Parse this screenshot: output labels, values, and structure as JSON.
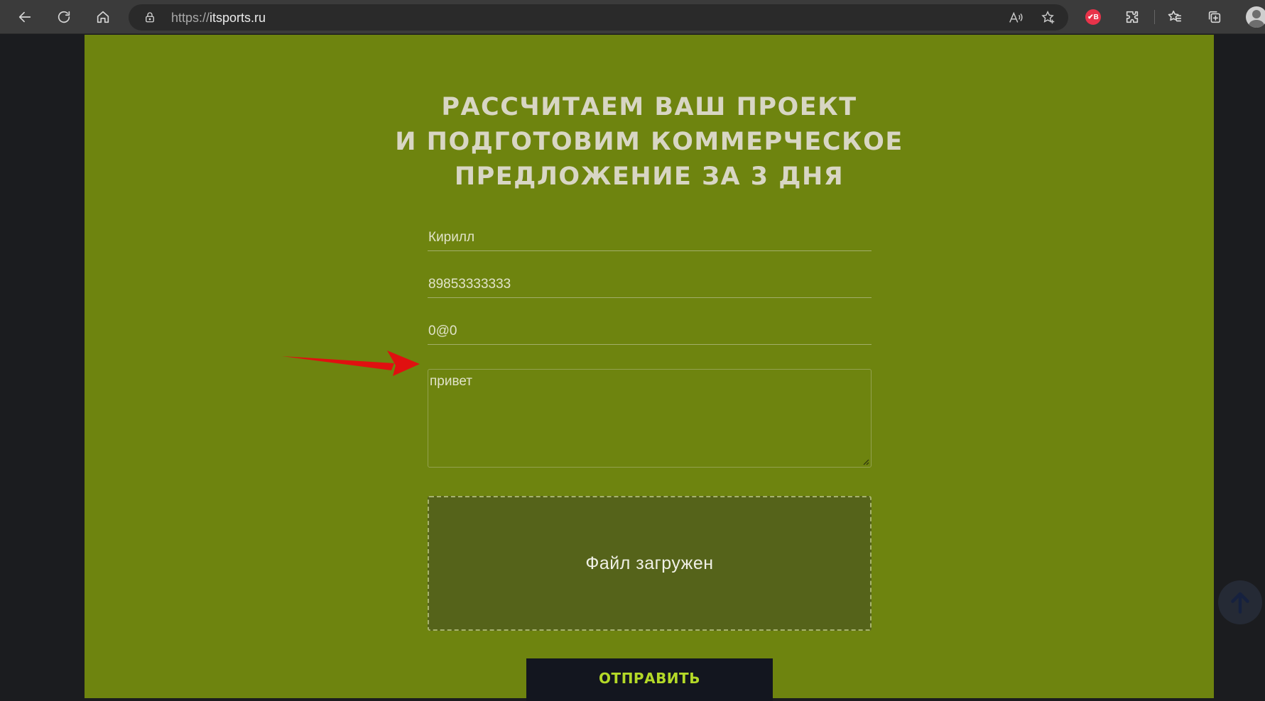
{
  "browser": {
    "url_scheme": "https://",
    "url_host": "itsports.ru",
    "extension_badge": "✔B"
  },
  "form": {
    "title_lines": [
      "РАССЧИТАЕМ ВАШ ПРОЕКТ",
      "И ПОДГОТОВИМ КОММЕРЧЕСКОЕ",
      "ПРЕДЛОЖЕНИЕ ЗА 3 ДНЯ"
    ],
    "name_value": "Кирилл",
    "phone_value": "89853333333",
    "email_value": "0@0",
    "message_value": "привет",
    "file_status": "Файл загружен",
    "submit_label": "ОТПРАВИТЬ"
  },
  "colors": {
    "panel_background": "#6e840f",
    "dropzone_background": "#55631a",
    "submit_background": "#13161f",
    "submit_text": "#b4d928",
    "annotation_arrow": "#e01010"
  }
}
